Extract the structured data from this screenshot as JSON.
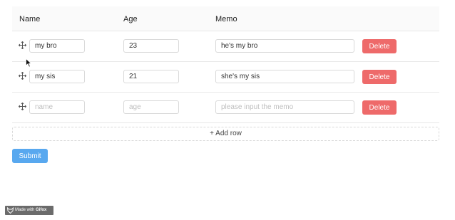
{
  "table": {
    "columns": {
      "name": "Name",
      "age": "Age",
      "memo": "Memo"
    },
    "rows": [
      {
        "name": "my bro",
        "age": "23",
        "memo": "he's my bro",
        "delete": "Delete"
      },
      {
        "name": "my sis",
        "age": "21",
        "memo": "she's my sis",
        "delete": "Delete"
      },
      {
        "name": "",
        "age": "",
        "memo": "",
        "delete": "Delete"
      }
    ],
    "placeholders": {
      "name": "name",
      "age": "age",
      "memo": "please input the memo"
    }
  },
  "add_row_label": "+ Add row",
  "submit_label": "Submit",
  "watermark": {
    "prefix": "Made with",
    "brand": "Gifox"
  },
  "colors": {
    "delete": "#ee6a6a",
    "submit": "#58a8ef"
  }
}
